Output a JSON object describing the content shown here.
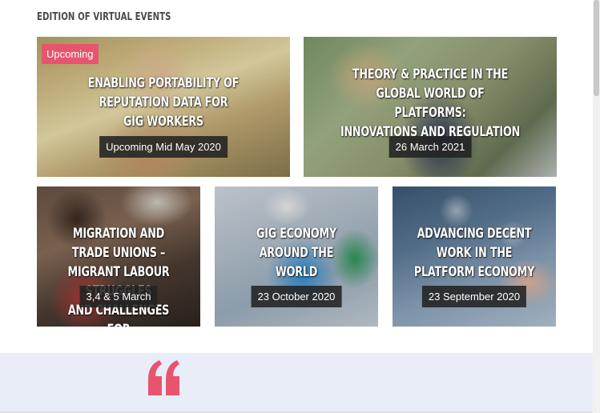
{
  "section": {
    "title": "EDITION OF VIRTUAL EVENTS"
  },
  "events": [
    {
      "title": "ENABLING PORTABILITY OF REPUTATION DATA FOR\nGIG WORKERS",
      "date": "Upcoming Mid May 2020",
      "badge": "Upcoming"
    },
    {
      "title": "THEORY & PRACTICE IN THE GLOBAL WORLD OF\nPLATFORMS:\nINNOVATIONS AND REGULATION",
      "date": "26 March 2021"
    },
    {
      "title": "MIGRATION AND TRADE UNIONS –\nMIGRANT LABOUR STRUGGLES\nAND CHALLENGES FOR\nORGANISING",
      "date": "3,4 & 5 March"
    },
    {
      "title": "GIG ECONOMY AROUND THE\nWORLD",
      "date": "23 October 2020"
    },
    {
      "title": "ADVANCING DECENT WORK IN THE\nPLATFORM ECONOMY",
      "date": "23 September 2020"
    }
  ],
  "quote": {
    "icon": "quote-mark-icon",
    "color": "#e8546e"
  },
  "colors": {
    "badge": "#e8546e",
    "band": "#e9edf8",
    "date_bg": "#222222"
  }
}
